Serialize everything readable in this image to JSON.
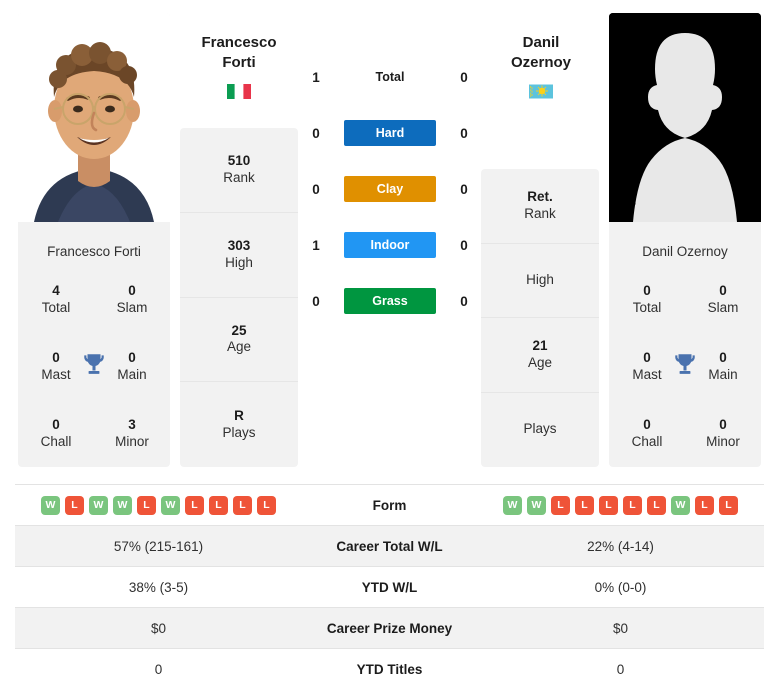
{
  "players": {
    "left": {
      "first_name": "Francesco",
      "last_name": "Forti",
      "full_name": "Francesco Forti",
      "name_block": "Francesco\nForti",
      "flag": "italy-flag",
      "flag_country": "Italy",
      "photo": "player-photo",
      "rank_rows": [
        {
          "value": "510",
          "label": "Rank"
        },
        {
          "value": "303",
          "label": "High"
        },
        {
          "value": "25",
          "label": "Age"
        },
        {
          "value": "R",
          "label": "Plays"
        }
      ],
      "titles": [
        {
          "value": "4",
          "label": "Total"
        },
        {
          "value": "0",
          "label": "Slam"
        },
        {
          "value": "0",
          "label": "Mast"
        },
        {
          "value": "0",
          "label": "Main"
        },
        {
          "value": "0",
          "label": "Chall"
        },
        {
          "value": "3",
          "label": "Minor"
        }
      ],
      "form": [
        "W",
        "L",
        "W",
        "W",
        "L",
        "W",
        "L",
        "L",
        "L",
        "L"
      ],
      "career_total_wl": "57% (215-161)",
      "ytd_wl": "38% (3-5)",
      "career_prize_money": "$0",
      "ytd_titles": "0"
    },
    "right": {
      "first_name": "Danil",
      "last_name": "Ozernoy",
      "full_name": "Danil Ozernoy",
      "name_block": "Danil\nOzernoy",
      "flag": "kazakhstan-flag",
      "flag_country": "Kazakhstan",
      "photo": "player-photo-placeholder",
      "rank_rows": [
        {
          "value": "Ret.",
          "label": "Rank"
        },
        {
          "value": "",
          "label": "High"
        },
        {
          "value": "21",
          "label": "Age"
        },
        {
          "value": "",
          "label": "Plays"
        }
      ],
      "titles": [
        {
          "value": "0",
          "label": "Total"
        },
        {
          "value": "0",
          "label": "Slam"
        },
        {
          "value": "0",
          "label": "Mast"
        },
        {
          "value": "0",
          "label": "Main"
        },
        {
          "value": "0",
          "label": "Chall"
        },
        {
          "value": "0",
          "label": "Minor"
        }
      ],
      "form": [
        "W",
        "W",
        "L",
        "L",
        "L",
        "L",
        "L",
        "W",
        "L",
        "L"
      ],
      "career_total_wl": "22% (4-14)",
      "ytd_wl": "0% (0-0)",
      "career_prize_money": "$0",
      "ytd_titles": "0"
    }
  },
  "head_to_head": {
    "rows": [
      {
        "label": "Total",
        "left": "1",
        "right": "0",
        "color": ""
      },
      {
        "label": "Hard",
        "left": "0",
        "right": "0",
        "color": "#0d6cbd"
      },
      {
        "label": "Clay",
        "left": "0",
        "right": "0",
        "color": "#e09000"
      },
      {
        "label": "Indoor",
        "left": "1",
        "right": "0",
        "color": "#2196f3"
      },
      {
        "label": "Grass",
        "left": "0",
        "right": "0",
        "color": "#009640"
      }
    ]
  },
  "stats_table": {
    "rows": [
      {
        "label": "Form",
        "type": "form"
      },
      {
        "label": "Career Total W/L",
        "left": "57% (215-161)",
        "right": "22% (4-14)"
      },
      {
        "label": "YTD W/L",
        "left": "38% (3-5)",
        "right": "0% (0-0)"
      },
      {
        "label": "Career Prize Money",
        "left": "$0",
        "right": "$0"
      },
      {
        "label": "YTD Titles",
        "left": "0",
        "right": "0"
      }
    ]
  },
  "colors": {
    "hard": "#0d6cbd",
    "clay": "#e09000",
    "indoor": "#2196f3",
    "grass": "#009640",
    "win_badge": "#7ac57e",
    "loss_badge": "#ef5438",
    "card_bg": "#f2f2f2",
    "trophy": "#4a72ae"
  }
}
